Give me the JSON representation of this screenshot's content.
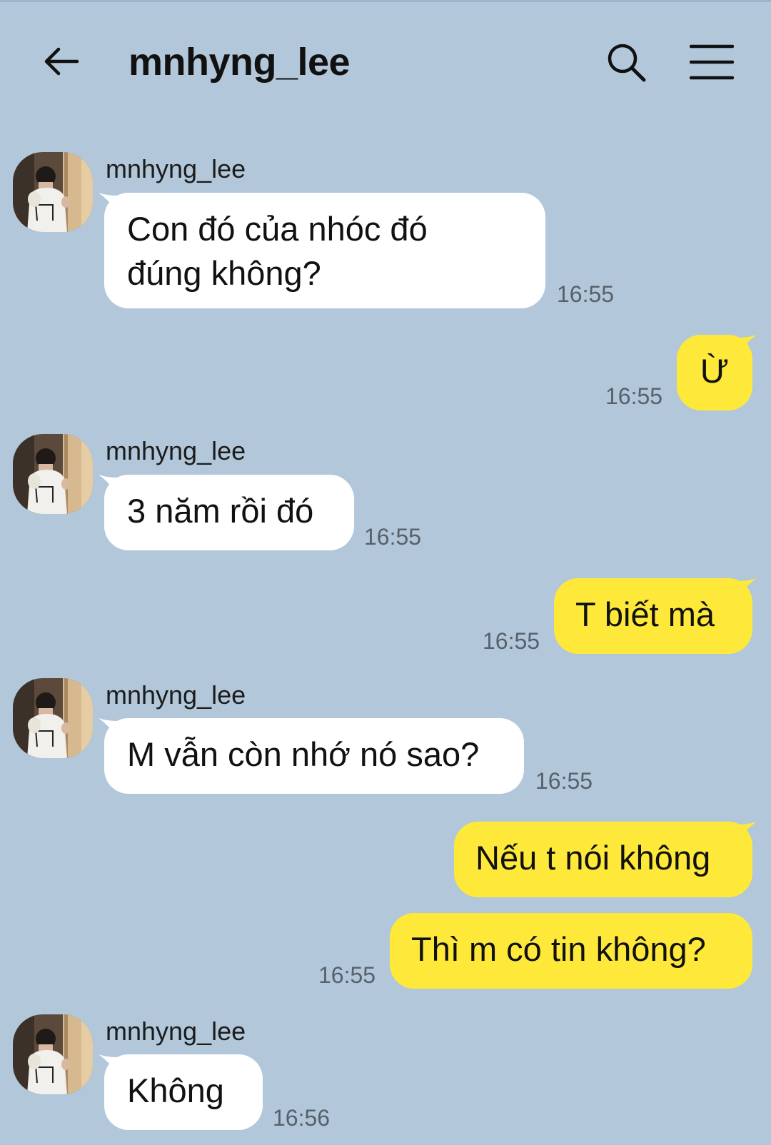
{
  "header": {
    "title": "mnhyng_lee",
    "back_icon": "back-arrow-icon",
    "search_icon": "search-icon",
    "menu_icon": "menu-icon"
  },
  "colors": {
    "background": "#b2c7da",
    "incoming_bubble": "#ffffff",
    "outgoing_bubble": "#fee93a"
  },
  "messages": [
    {
      "direction": "in",
      "sender": "mnhyng_lee",
      "text": "Con đó của nhóc đó\nđúng không?",
      "time": "16:55"
    },
    {
      "direction": "out",
      "text": "Ừ",
      "time": "16:55"
    },
    {
      "direction": "in",
      "sender": "mnhyng_lee",
      "text": "3 năm rồi đó",
      "time": "16:55"
    },
    {
      "direction": "out",
      "text": "T biết mà",
      "time": "16:55"
    },
    {
      "direction": "in",
      "sender": "mnhyng_lee",
      "text": "M vẫn còn nhớ nó sao?",
      "time": "16:55"
    },
    {
      "direction": "out",
      "text": "Nếu t nói không",
      "time": ""
    },
    {
      "direction": "out",
      "text": "Thì m có tin không?",
      "time": "16:55"
    },
    {
      "direction": "in",
      "sender": "mnhyng_lee",
      "text": "Không",
      "time": "16:56"
    }
  ]
}
